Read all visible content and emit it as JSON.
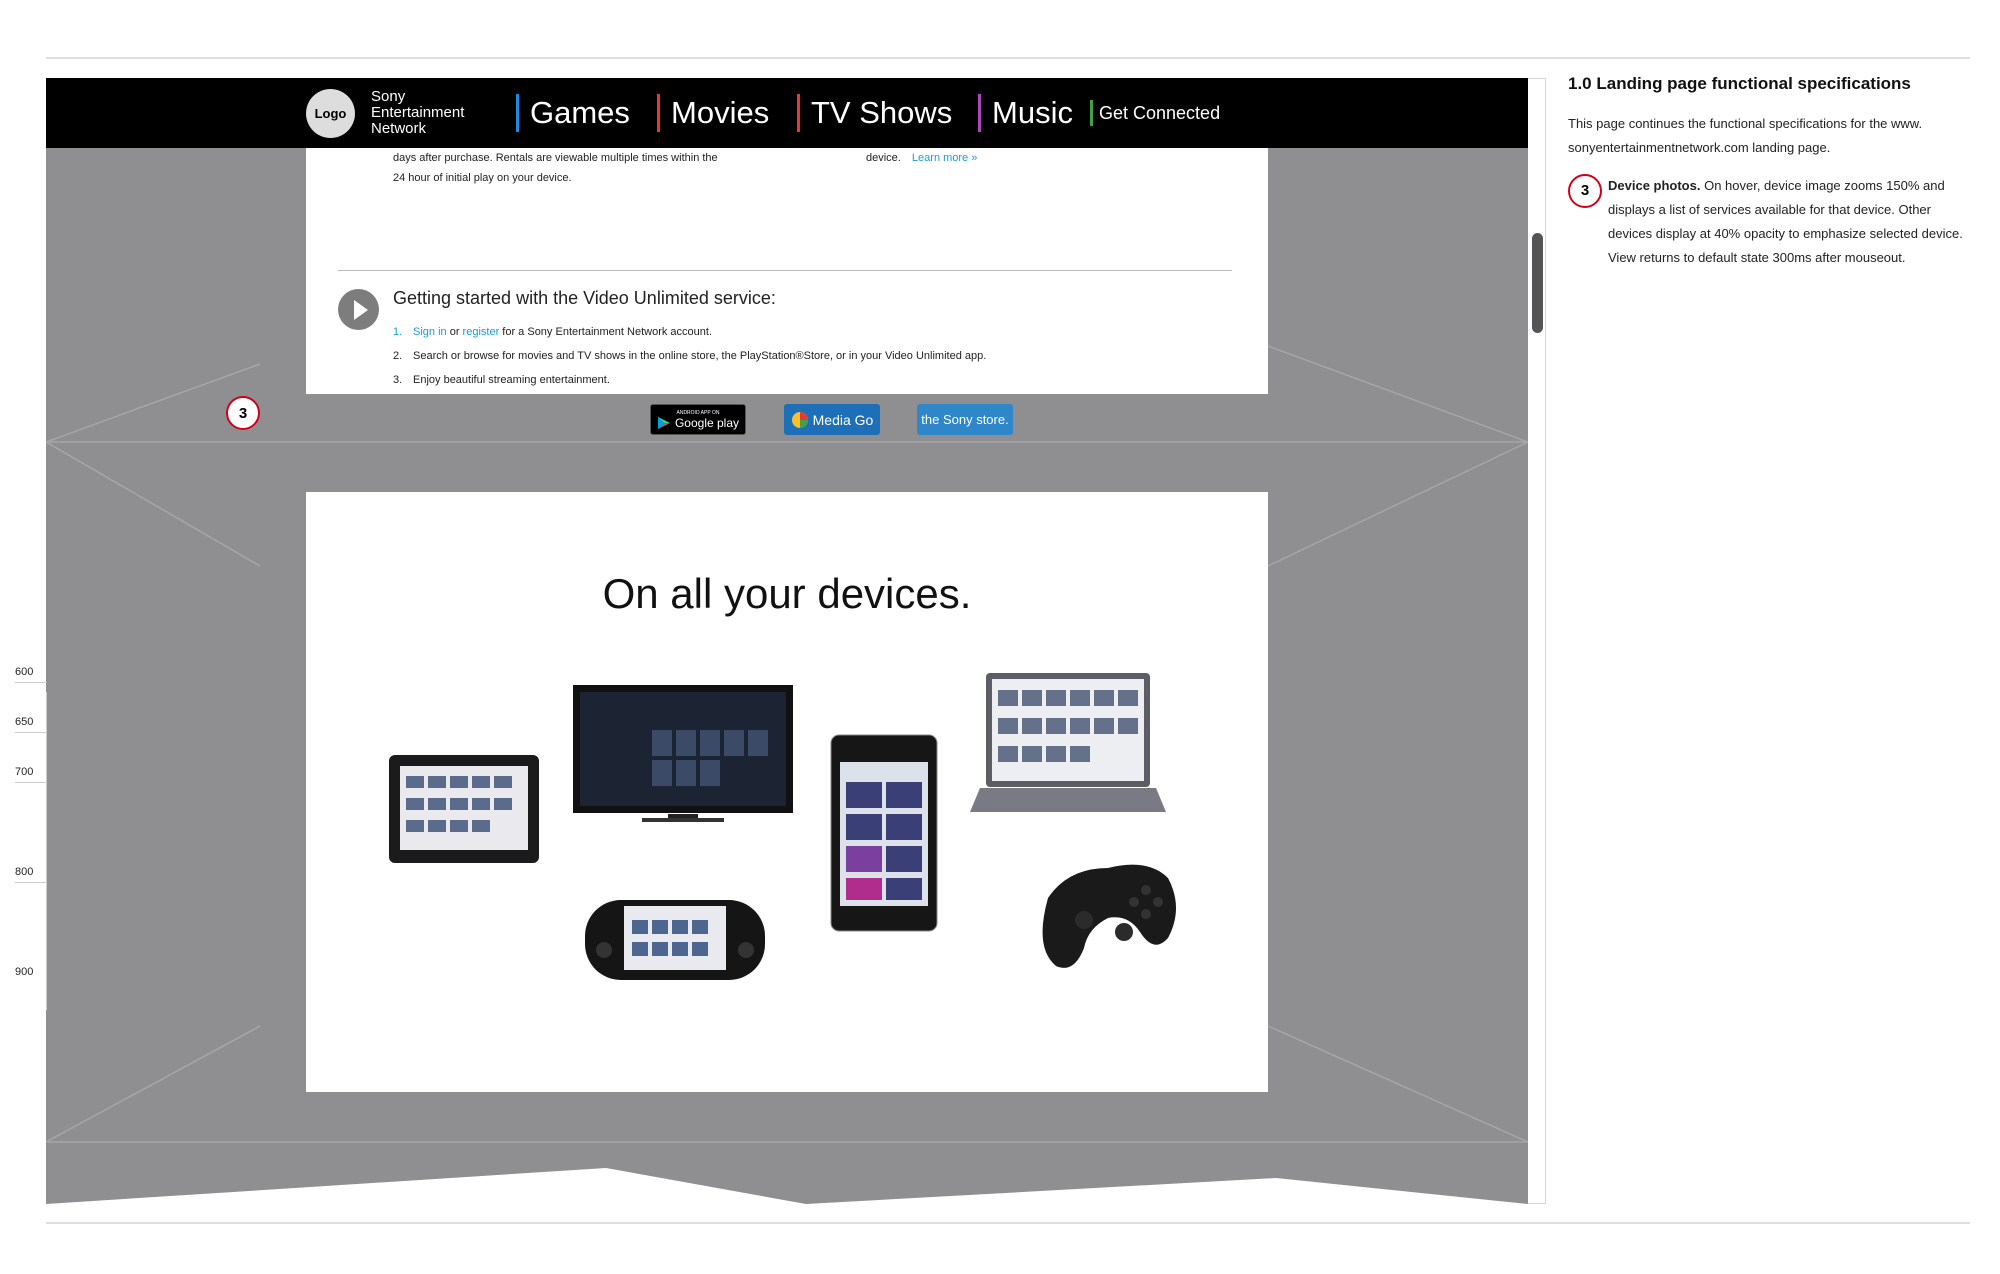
{
  "nav": {
    "logo": "Logo",
    "brand": [
      "Sony",
      "Entertainment",
      "Network"
    ],
    "items": [
      {
        "label": "Games",
        "color": "#1e88e5"
      },
      {
        "label": "Movies",
        "color": "#e53935"
      },
      {
        "label": "TV Shows",
        "color": "#e53935"
      },
      {
        "label": "Music",
        "color": "#ab47bc"
      },
      {
        "label": "Get Connected",
        "color": "#43a047"
      }
    ]
  },
  "rental": {
    "line1": "days after purchase. Rentals are viewable multiple times within the",
    "line2": "24 hour of initial play on your device.",
    "right_text": "device.",
    "learn_more": "Learn more »"
  },
  "getting_started": {
    "title": "Getting started with the Video Unlimited service:",
    "step1_num": "1.",
    "step1_signin": "Sign in",
    "step1_or": " or ",
    "step1_register": "register",
    "step1_rest": " for a Sony Entertainment Network account.",
    "step2_num": "2.",
    "step2": "Search or browse for movies and TV shows in the online store, the PlayStation®Store, or in your Video Unlimited app.",
    "step3_num": "3.",
    "step3": "Enjoy beautiful streaming entertainment."
  },
  "stores": {
    "google_play_small": "ANDROID APP ON",
    "google_play": "Google play",
    "media_go": "Media Go",
    "sony_store": "the Sony store."
  },
  "devices": {
    "title": "On all your devices.",
    "marker": "3"
  },
  "ruler": [
    "600",
    "650",
    "700",
    "800",
    "900"
  ],
  "spec": {
    "title": "1.0 Landing page functional specifications",
    "intro": "This page continues the functional specifications for the www. sonyentertainmentnetwork.com landing page.",
    "marker": "3",
    "item_title": "Device photos.",
    "item_body": " On hover, device image zooms 150% and displays a list of services available for that device. Other devices display at 40% opacity to emphasize selected device. View returns to default state 300ms after mouseout."
  },
  "colors": {
    "accent_red": "#d0021b",
    "link": "#1a9bd7",
    "canvas_gray": "#8f8f92"
  }
}
